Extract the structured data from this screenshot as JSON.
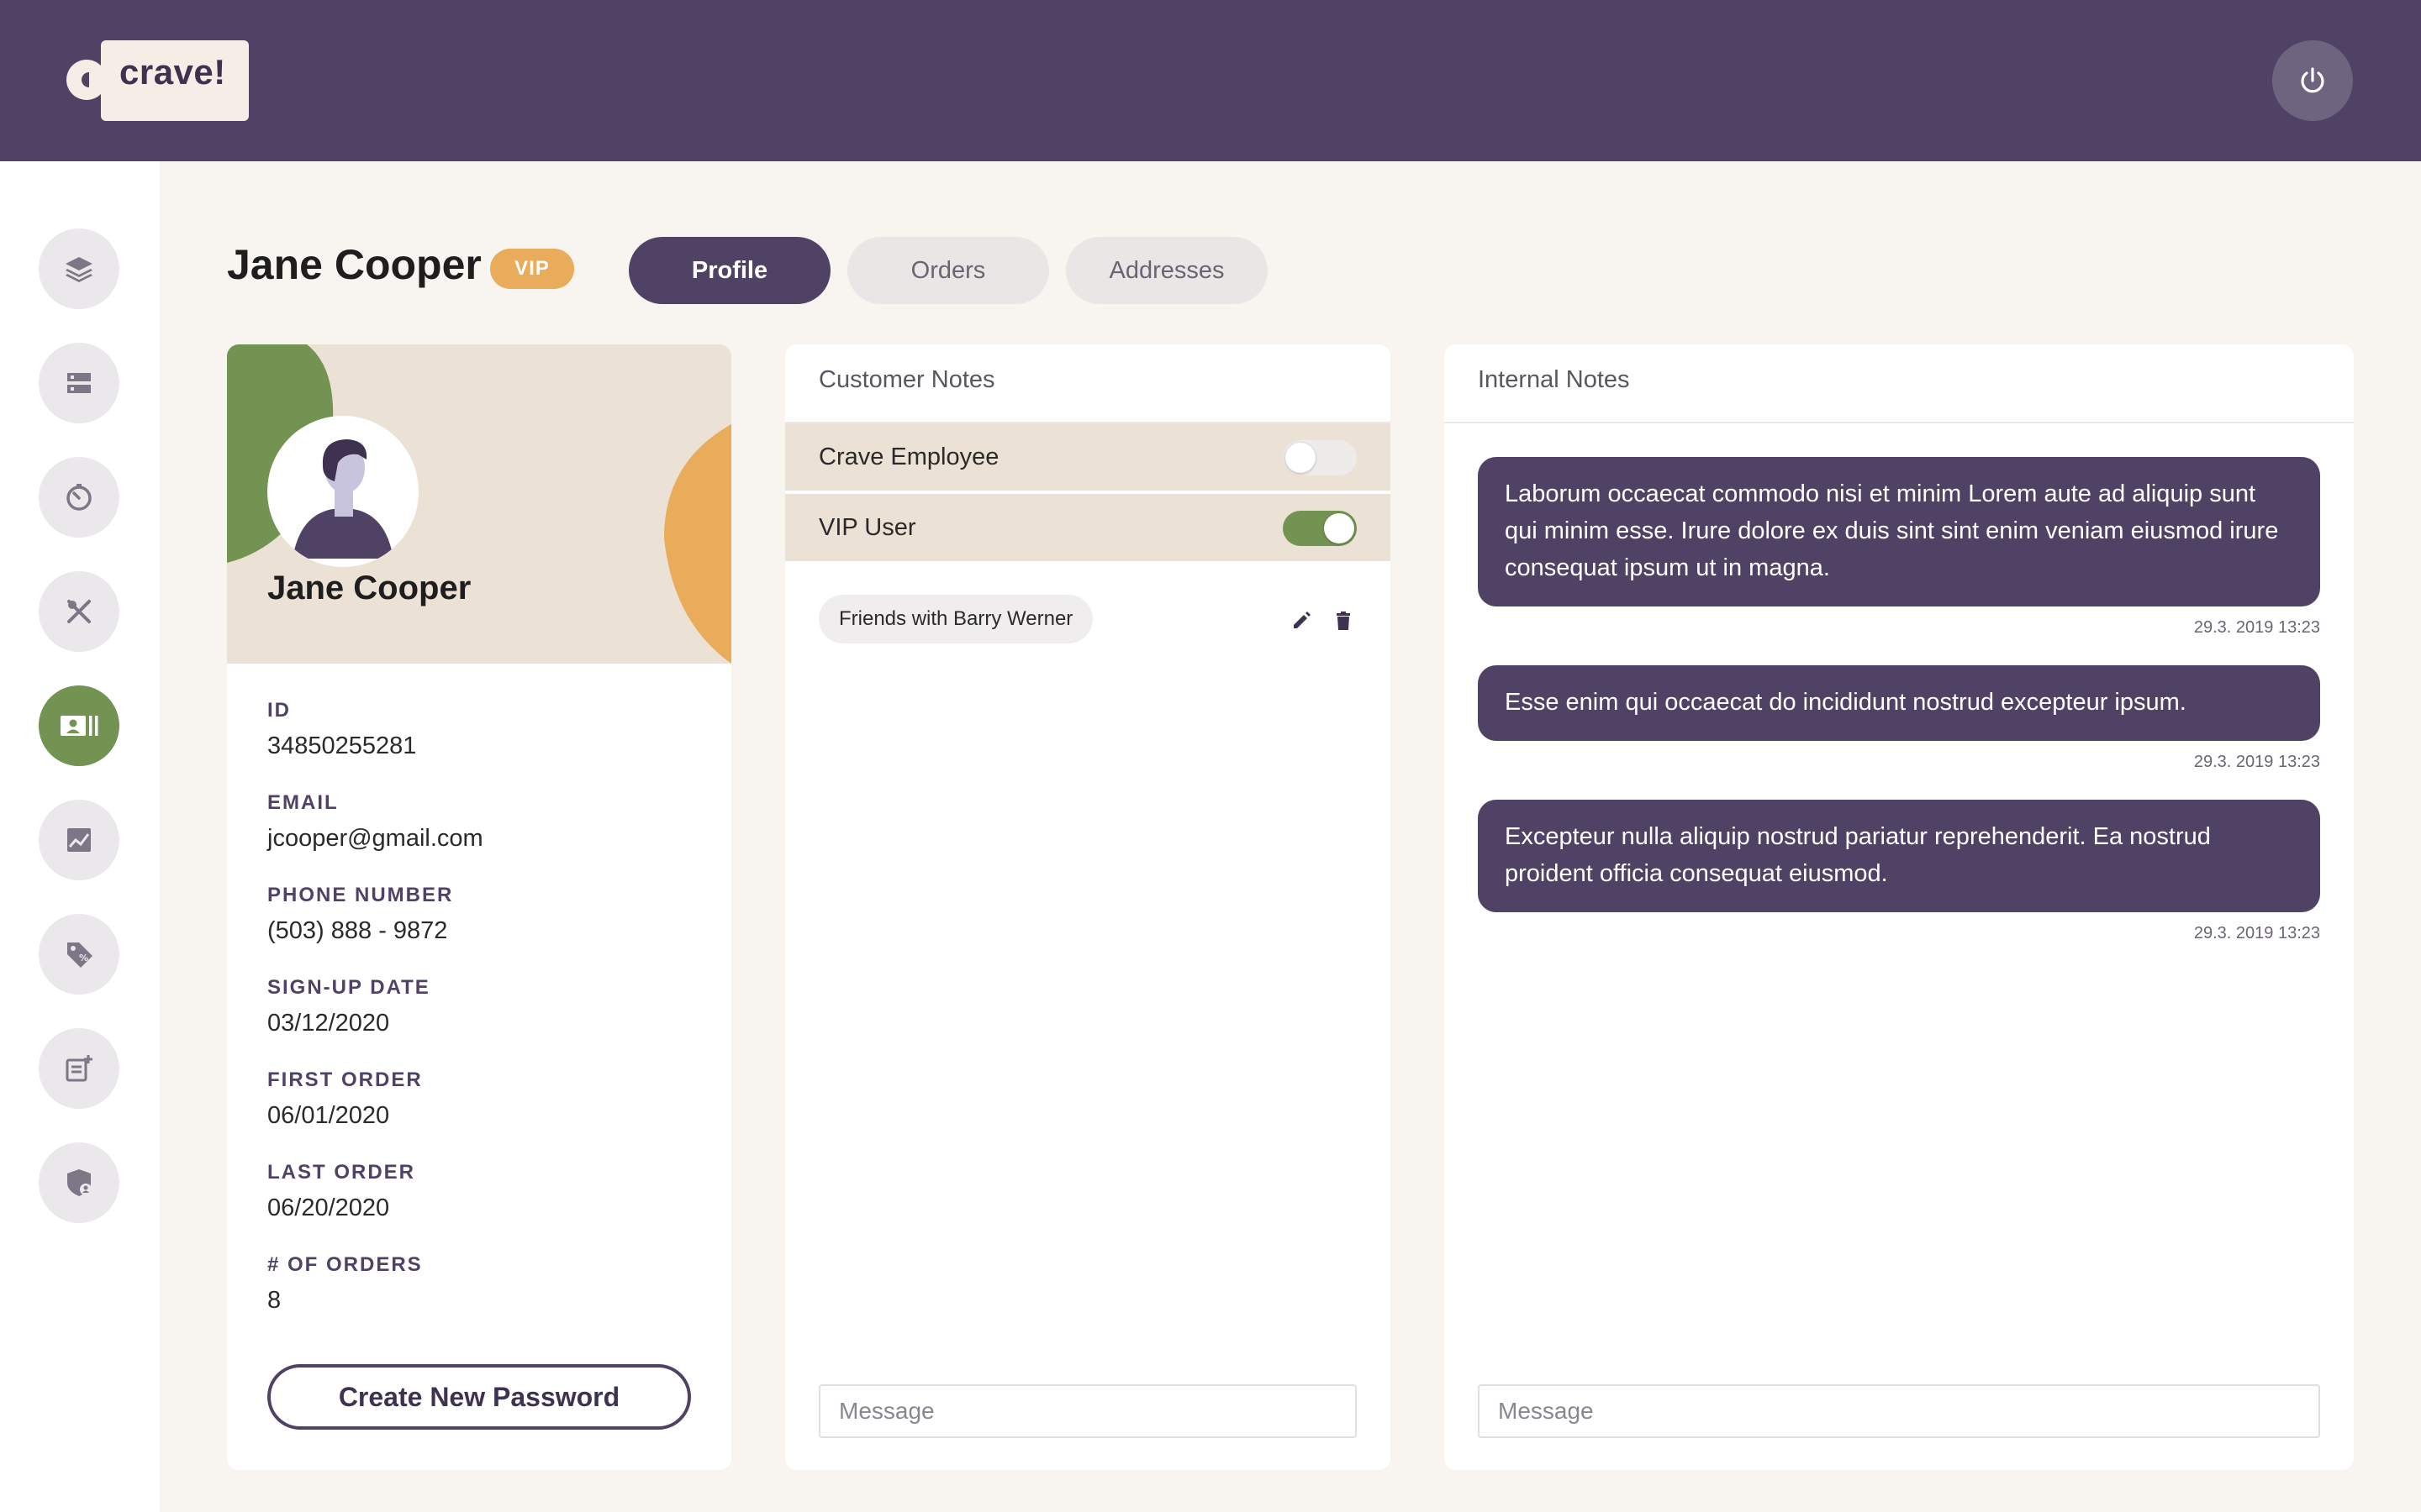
{
  "header": {
    "logo_text": "crave!",
    "power_icon": "power-icon"
  },
  "sidebar": {
    "items": [
      {
        "icon": "layers-icon",
        "active": false
      },
      {
        "icon": "server-icon",
        "active": false
      },
      {
        "icon": "timer-icon",
        "active": false
      },
      {
        "icon": "utensils-icon",
        "active": false
      },
      {
        "icon": "customer-card-icon",
        "active": true
      },
      {
        "icon": "analytics-icon",
        "active": false
      },
      {
        "icon": "discount-tag-icon",
        "active": false
      },
      {
        "icon": "add-post-icon",
        "active": false
      },
      {
        "icon": "admin-shield-icon",
        "active": false
      }
    ]
  },
  "page": {
    "title": "Jane Cooper",
    "badge": "VIP"
  },
  "tabs": [
    {
      "label": "Profile",
      "active": true
    },
    {
      "label": "Orders",
      "active": false
    },
    {
      "label": "Addresses",
      "active": false
    }
  ],
  "profile": {
    "name": "Jane Cooper",
    "fields": [
      {
        "label": "ID",
        "value": "34850255281"
      },
      {
        "label": "EMAIL",
        "value": "jcooper@gmail.com"
      },
      {
        "label": "PHONE NUMBER",
        "value": "(503) 888 - 9872"
      },
      {
        "label": "SIGN-UP DATE",
        "value": "03/12/2020"
      },
      {
        "label": "FIRST ORDER",
        "value": "06/01/2020"
      },
      {
        "label": "LAST ORDER",
        "value": "06/20/2020"
      },
      {
        "label": "# OF ORDERS",
        "value": "8"
      }
    ],
    "button_label": "Create New Password"
  },
  "customer_notes": {
    "title": "Customer Notes",
    "toggles": [
      {
        "label": "Crave Employee",
        "on": false
      },
      {
        "label": "VIP User",
        "on": true
      }
    ],
    "tags": [
      "Friends with Barry Werner"
    ],
    "message_placeholder": "Message"
  },
  "internal_notes": {
    "title": "Internal Notes",
    "notes": [
      {
        "text": "Laborum occaecat commodo nisi et minim Lorem aute ad aliquip sunt qui minim esse. Irure dolore ex duis sint sint enim veniam eiusmod irure consequat ipsum ut in magna.",
        "time": "29.3. 2019 13:23"
      },
      {
        "text": "Esse enim qui occaecat do incididunt nostrud excepteur ipsum.",
        "time": "29.3. 2019 13:23"
      },
      {
        "text": "Excepteur nulla aliquip nostrud pariatur reprehenderit. Ea nostrud proident officia consequat eiusmod.",
        "time": "29.3. 2019 13:23"
      }
    ],
    "message_placeholder": "Message"
  },
  "colors": {
    "primary": "#504265",
    "accent_green": "#729352",
    "accent_orange": "#e8ac5a",
    "banner": "#ece1d5",
    "background": "#f8f5f1"
  }
}
